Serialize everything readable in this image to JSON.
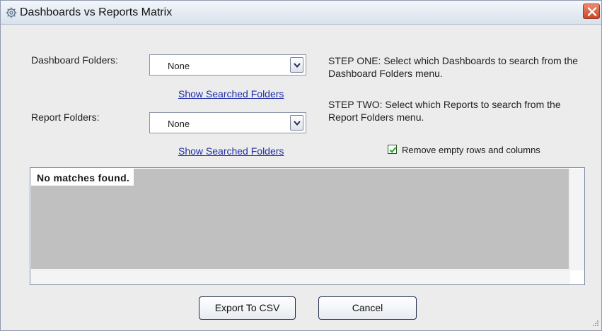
{
  "window": {
    "title": "Dashboards vs Reports Matrix",
    "title_icon": "gear-icon",
    "close_icon": "close-icon"
  },
  "form": {
    "dashboard_folders_label": "Dashboard Folders:",
    "dashboard_folders_value": "None",
    "report_folders_label": "Report Folders:",
    "report_folders_value": "None",
    "show_searched_folders_link_1": "Show Searched Folders",
    "show_searched_folders_link_2": "Show Searched Folders"
  },
  "instructions": {
    "step_one": "STEP ONE: Select which Dashboards to search from the Dashboard Folders menu.",
    "step_two": "STEP TWO: Select which Reports to search from the Report Folders menu."
  },
  "options": {
    "remove_empty_label": "Remove empty rows and columns",
    "remove_empty_checked": true
  },
  "results": {
    "message": "No matches found."
  },
  "buttons": {
    "export_label": "Export To CSV",
    "cancel_label": "Cancel"
  },
  "colors": {
    "link": "#1f2ea8",
    "grid_background": "#c0c0c0",
    "close_button": "#c9462b"
  }
}
